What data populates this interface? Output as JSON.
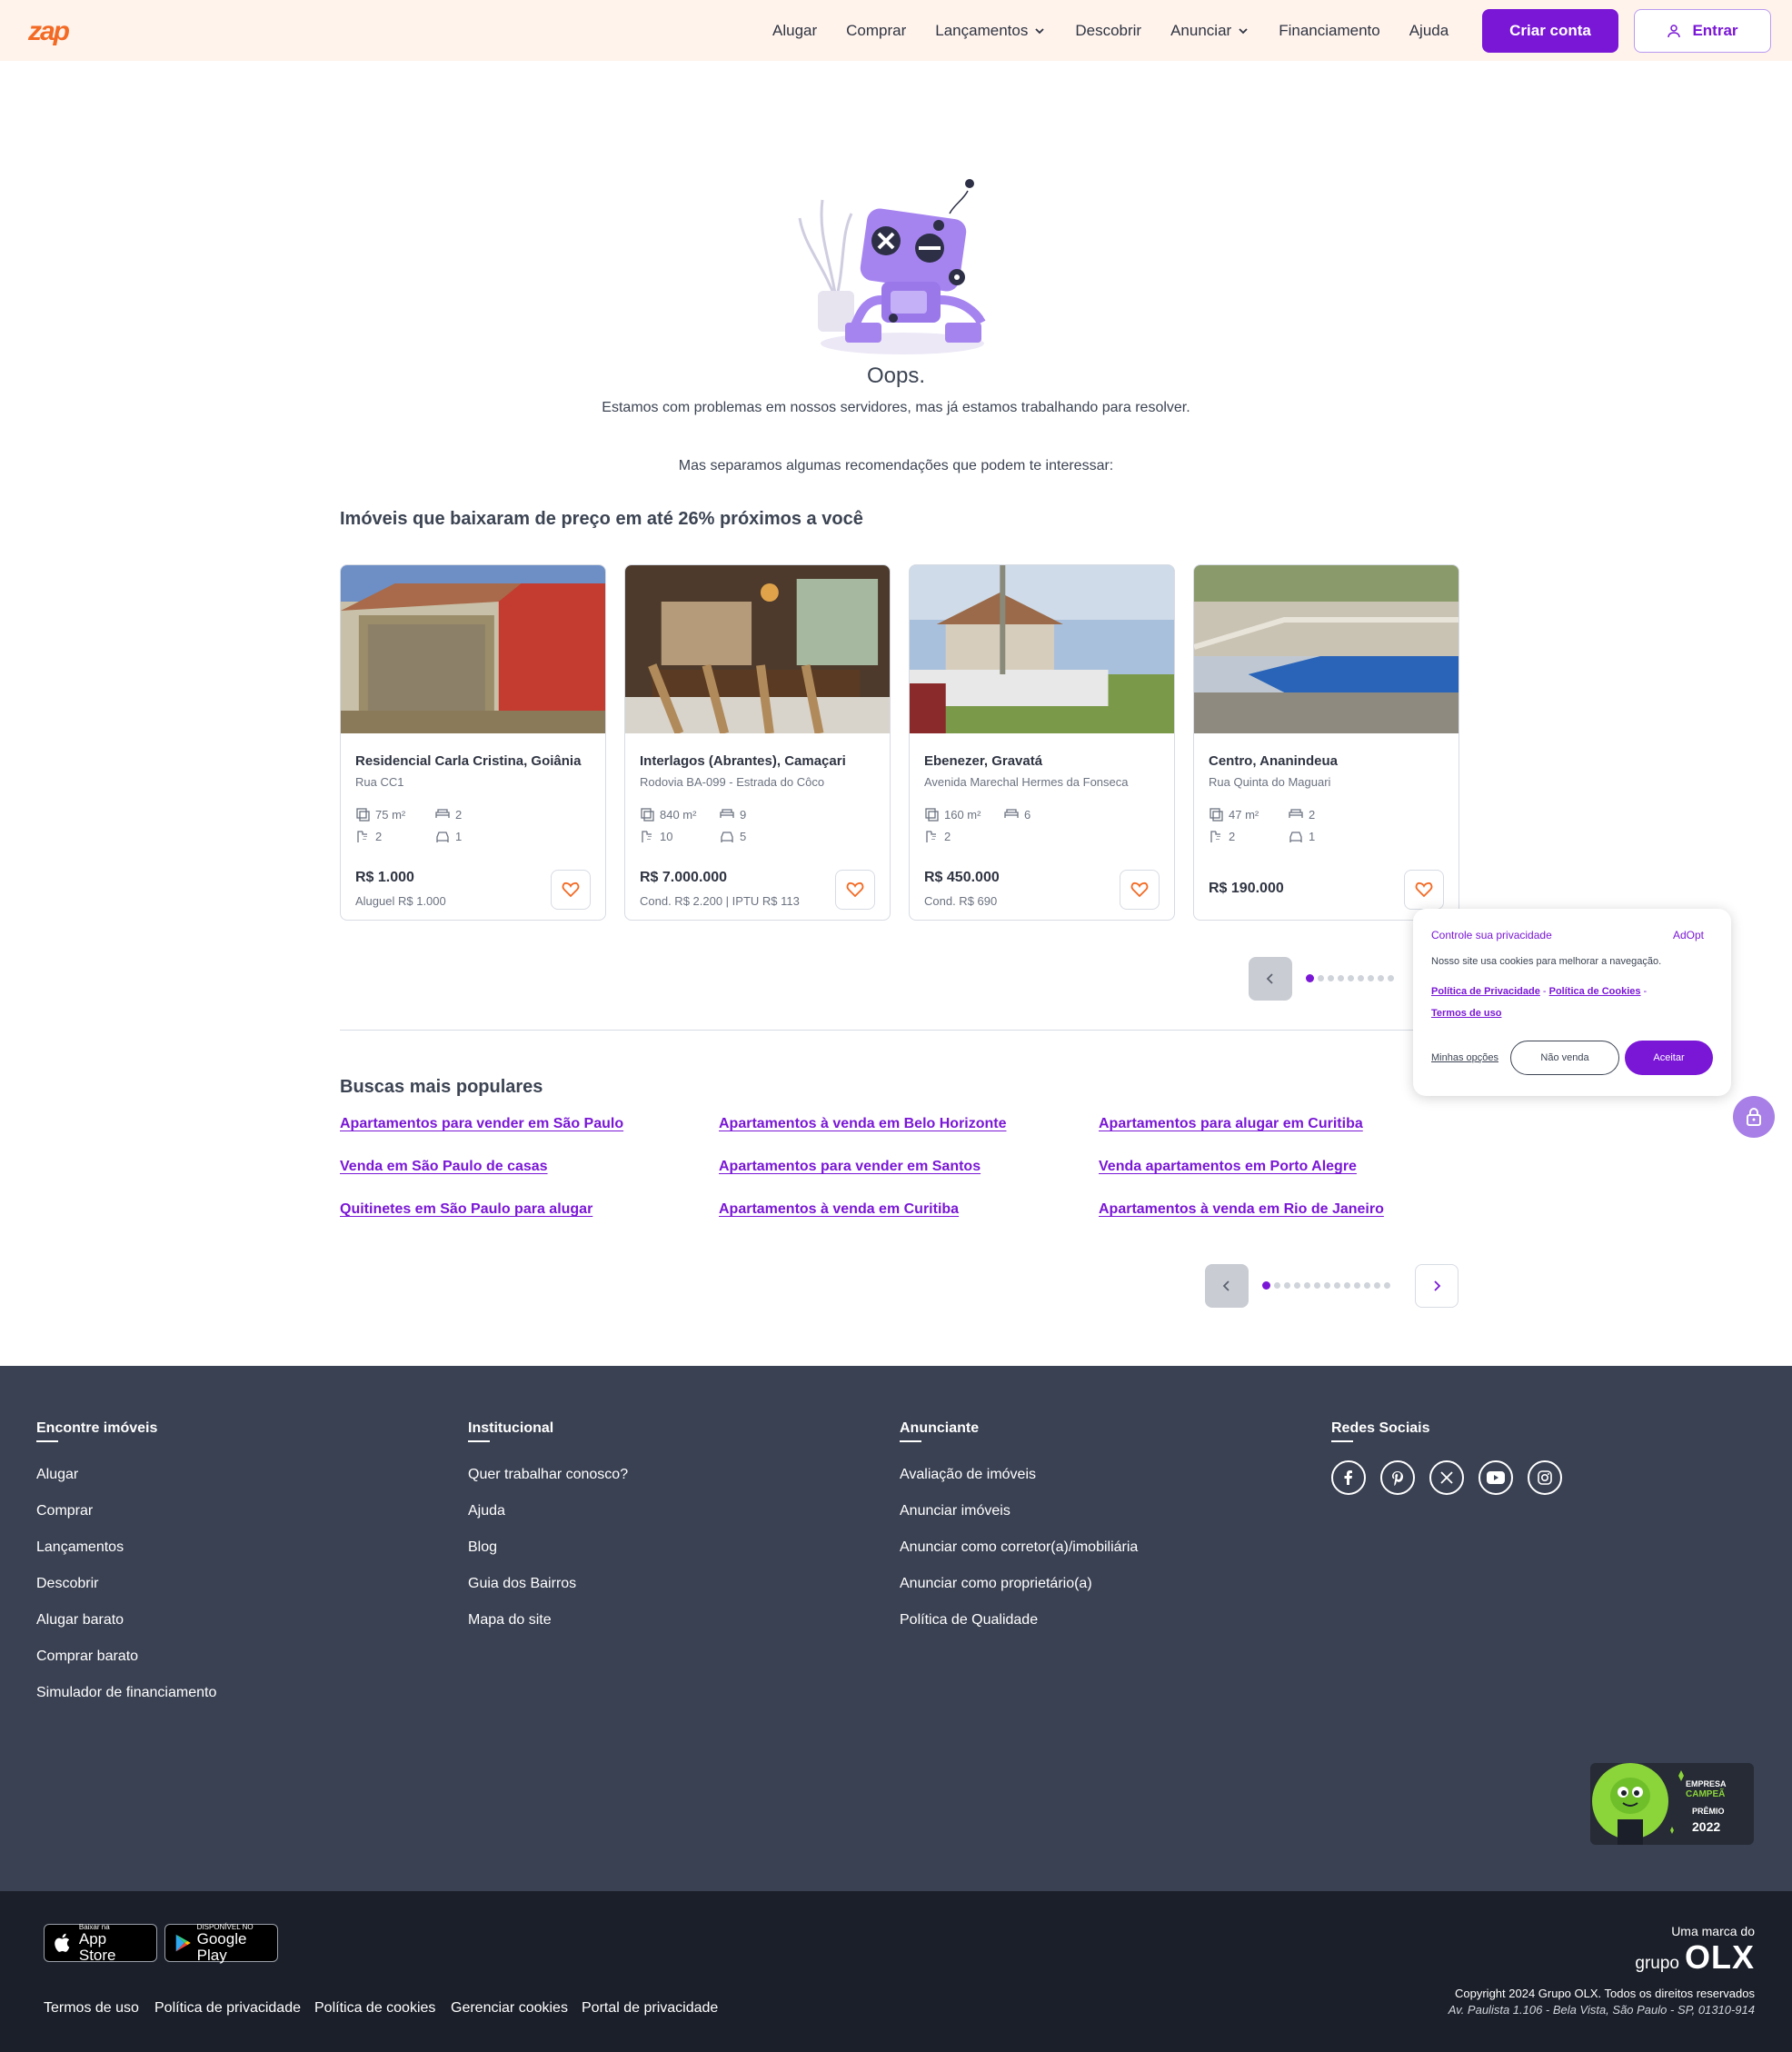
{
  "header": {
    "logo": "zap",
    "nav": [
      "Alugar",
      "Comprar",
      "Lançamentos",
      "Descobrir",
      "Anunciar",
      "Financiamento",
      "Ajuda"
    ],
    "criar_conta": "Criar conta",
    "entrar": "Entrar"
  },
  "error": {
    "title": "Oops.",
    "message": "Estamos com problemas em nossos servidores, mas já estamos trabalhando para resolver.",
    "recommendation": "Mas separamos algumas recomendações que podem te interessar:"
  },
  "recommendations": {
    "title": "Imóveis que baixaram de preço em até 26% próximos a você",
    "cards": [
      {
        "title": "Residencial Carla Cristina, Goiânia",
        "street": "Rua CC1",
        "area": "75 m²",
        "bedrooms": "2",
        "bathrooms": "2",
        "parking": "1",
        "price": "R$ 1.000",
        "sub": "Aluguel R$ 1.000"
      },
      {
        "title": "Interlagos (Abrantes), Camaçari",
        "street": "Rodovia BA-099 - Estrada do Côco",
        "area": "840 m²",
        "bedrooms": "9",
        "bathrooms": "10",
        "parking": "5",
        "price": "R$ 7.000.000",
        "sub": "Cond. R$ 2.200 | IPTU R$ 113"
      },
      {
        "title": "Ebenezer, Gravatá",
        "street": "Avenida Marechal Hermes da Fonseca",
        "area": "160 m²",
        "bedrooms": "6",
        "bathrooms": "2",
        "parking": "",
        "price": "R$ 450.000",
        "sub": "Cond. R$ 690"
      },
      {
        "title": "Centro, Ananindeua",
        "street": "Rua Quinta do Maguari",
        "area": "47 m²",
        "bedrooms": "2",
        "bathrooms": "2",
        "parking": "1",
        "price": "R$ 190.000",
        "sub": ""
      }
    ]
  },
  "popular": {
    "title": "Buscas mais populares",
    "links": [
      "Apartamentos para vender em São Paulo",
      "Apartamentos à venda em Belo Horizonte",
      "Apartamentos para alugar em Curitiba",
      "Venda em São Paulo de casas",
      "Apartamentos para vender em Santos",
      "Venda apartamentos em Porto Alegre",
      "Quitinetes em São Paulo para alugar",
      "Apartamentos à venda em Curitiba",
      "Apartamentos à venda em Rio de Janeiro"
    ]
  },
  "privacy": {
    "title": "Controle sua privacidade",
    "brand": "AdOpt",
    "text": "Nosso site usa cookies para melhorar a navegação.",
    "link1": "Política de Privacidade",
    "link2": "Política de Cookies",
    "link3": "Termos de uso",
    "minhas": "Minhas opções",
    "nao_venda": "Não venda",
    "aceitar": "Aceitar"
  },
  "footer": {
    "col1": {
      "title": "Encontre imóveis",
      "items": [
        "Alugar",
        "Comprar",
        "Lançamentos",
        "Descobrir",
        "Alugar barato",
        "Comprar barato",
        "Simulador de financiamento"
      ]
    },
    "col2": {
      "title": "Institucional",
      "items": [
        "Quer trabalhar conosco?",
        "Ajuda",
        "Blog",
        "Guia dos Bairros",
        "Mapa do site"
      ]
    },
    "col3": {
      "title": "Anunciante",
      "items": [
        "Avaliação de imóveis",
        "Anunciar imóveis",
        "Anunciar como corretor(a)/imobiliária",
        "Anunciar como proprietário(a)",
        "Política de Qualidade"
      ]
    },
    "col4": {
      "title": "Redes Sociais"
    },
    "badge": {
      "line1": "EMPRESA",
      "line2": "CAMPEÃ",
      "line3": "PRÊMIO",
      "year": "2022"
    }
  },
  "bottom": {
    "appstore_small": "Baixar na",
    "appstore_big": "App Store",
    "googleplay_small": "DISPONÍVEL NO",
    "googleplay_big": "Google Play",
    "links": [
      "Termos de uso",
      "Política de privacidade",
      "Política de cookies",
      "Gerenciar cookies",
      "Portal de privacidade"
    ],
    "marca": "Uma marca do",
    "grupo": "grupo",
    "olx": "OLX",
    "copyright": "Copyright 2024 Grupo OLX. Todos os direitos reservados",
    "address": "Av. Paulista 1.106 - Bela Vista, São Paulo - SP, 01310-914"
  },
  "colors": {
    "accent": "#7a17d6",
    "brand": "#f36a24",
    "footer": "#3a4152",
    "favorite": "#f36a24"
  }
}
